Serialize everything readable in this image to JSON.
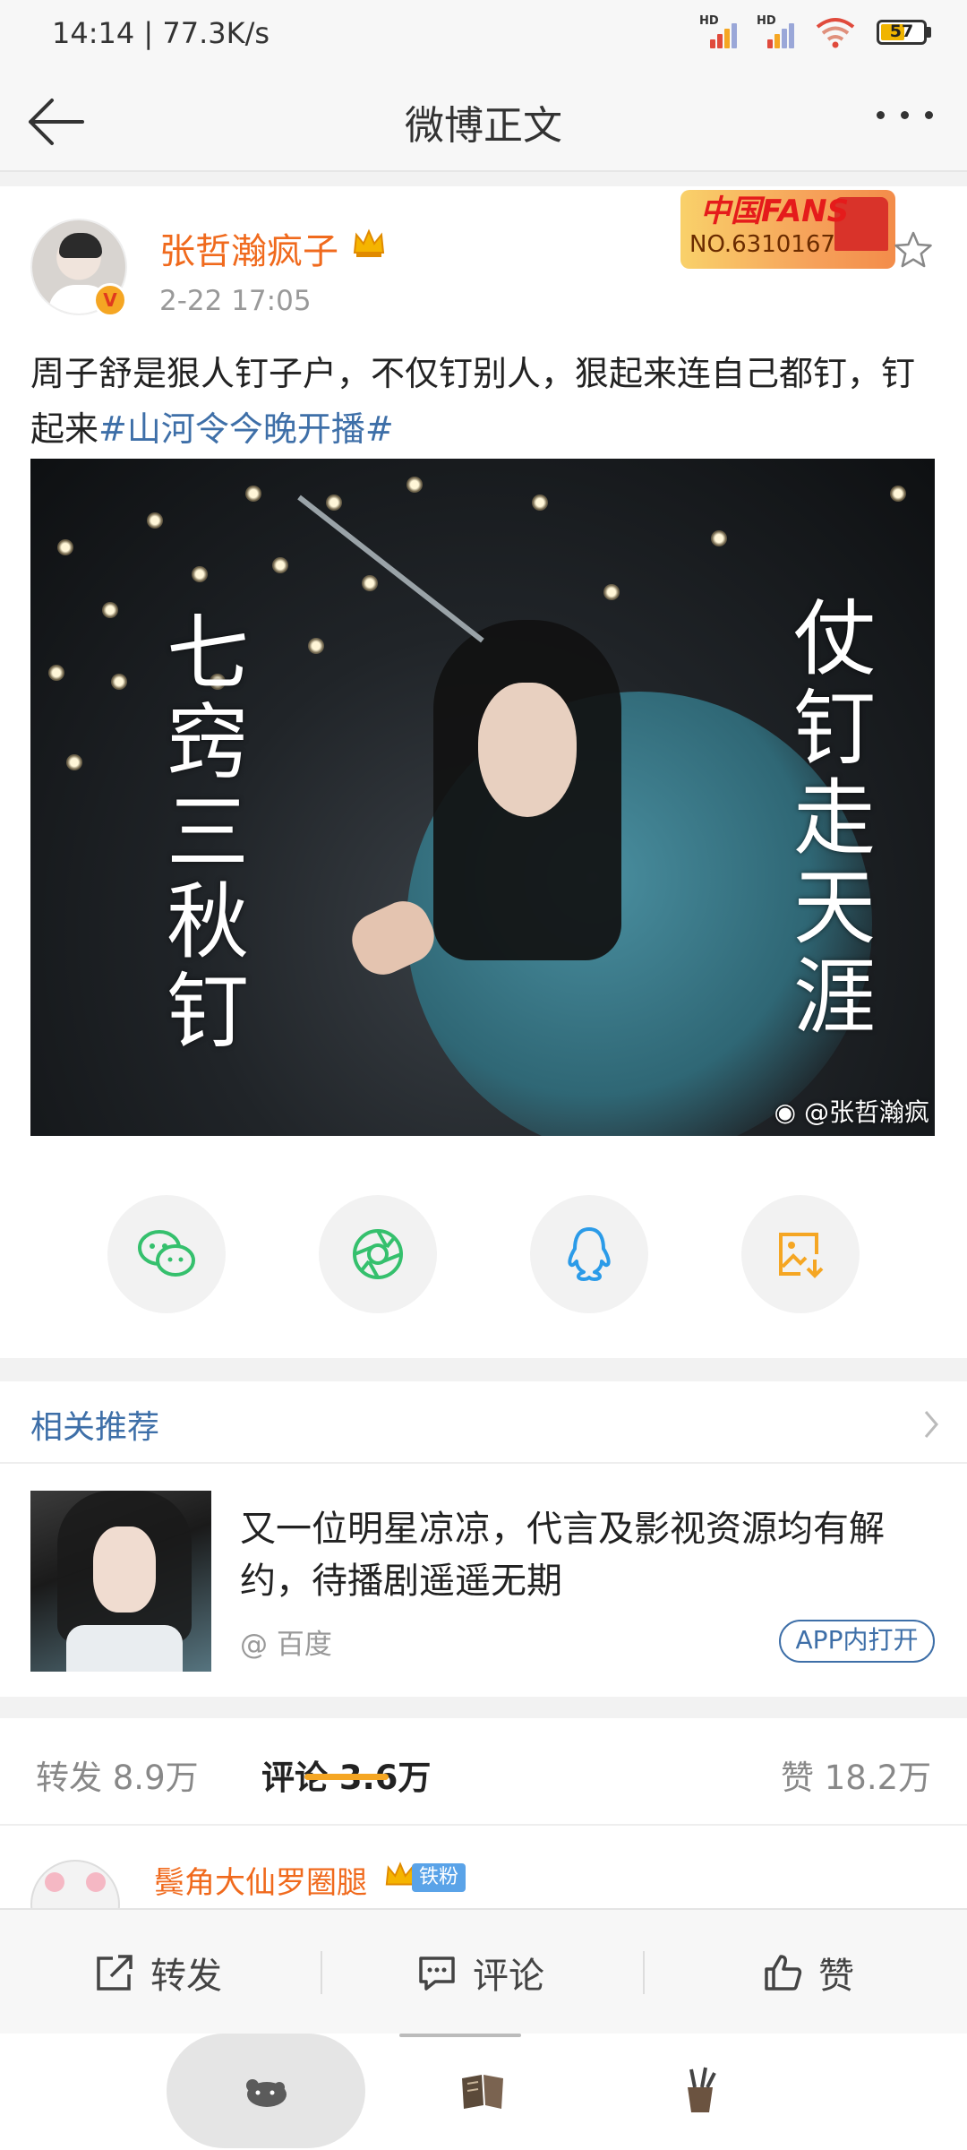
{
  "status_bar": {
    "time": "14:14 | 77.3K/s",
    "battery": "57"
  },
  "header": {
    "title": "微博正文"
  },
  "post": {
    "username": "张哲瀚疯子",
    "time": "2-22 17:05",
    "fans_badge_top": "中国FANS",
    "fans_badge_no": "NO.6310167",
    "text_plain": "周子舒是狠人钉子户，不仅钉别人，狠起来连自己都钉，钉起来",
    "text_tag": "#山河令今晚开播#",
    "image_text_left": [
      "七",
      "窍",
      "三",
      "秋",
      "钉"
    ],
    "image_text_right": [
      "仗",
      "钉",
      "走",
      "天",
      "涯"
    ],
    "image_watermark": "@张哲瀚疯"
  },
  "share": {
    "icons": [
      "wechat-icon",
      "moments-icon",
      "qq-icon",
      "save-image-icon"
    ]
  },
  "related": {
    "header": "相关推荐",
    "title": "又一位明星凉凉，代言及影视资源均有解约，待播剧遥遥无期",
    "source": "@ 百度",
    "open_label": "APP内打开"
  },
  "tabs": {
    "repost": "转发 8.9万",
    "comment": "评论 3.6万",
    "like": "赞 18.2万"
  },
  "comment_preview": {
    "name": "鬓角大仙罗圈腿",
    "badge": "铁粉"
  },
  "actions": {
    "repost": "转发",
    "comment": "评论",
    "like": "赞"
  },
  "colors": {
    "accent_orange": "#f06a1d",
    "link_blue": "#3e6fa8",
    "tab_underline": "#f5a623"
  }
}
